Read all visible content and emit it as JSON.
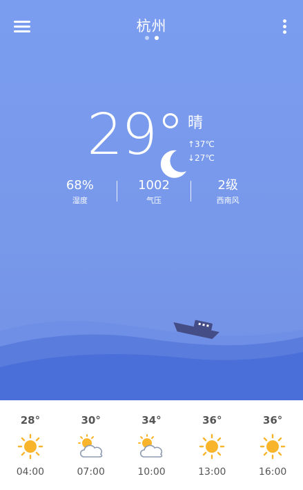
{
  "header": {
    "city": "杭州",
    "page_dots": 2,
    "active_dot": 1
  },
  "current": {
    "temperature": "29°",
    "condition": "晴",
    "high": "↑37℃",
    "low": "↓27℃",
    "condition_icon": "moon-icon"
  },
  "stats": {
    "humidity_value": "68%",
    "humidity_label": "湿度",
    "pressure_value": "1002",
    "pressure_label": "气压",
    "wind_value": "2级",
    "wind_label": "西南风"
  },
  "forecast": [
    {
      "temp": "28°",
      "icon": "sun-icon",
      "time": "04:00"
    },
    {
      "temp": "30°",
      "icon": "partly-cloudy-icon",
      "time": "07:00"
    },
    {
      "temp": "34°",
      "icon": "partly-cloudy-icon",
      "time": "10:00"
    },
    {
      "temp": "36°",
      "icon": "sun-icon",
      "time": "13:00"
    },
    {
      "temp": "36°",
      "icon": "sun-icon",
      "time": "16:00"
    }
  ],
  "colors": {
    "sky": "#7b9df0",
    "wave_front": "#4a6fd8",
    "sun": "#f8b52b",
    "cloud_stroke": "#8c9bb0",
    "boat": "#454d86",
    "forecast_text": "#555555"
  }
}
